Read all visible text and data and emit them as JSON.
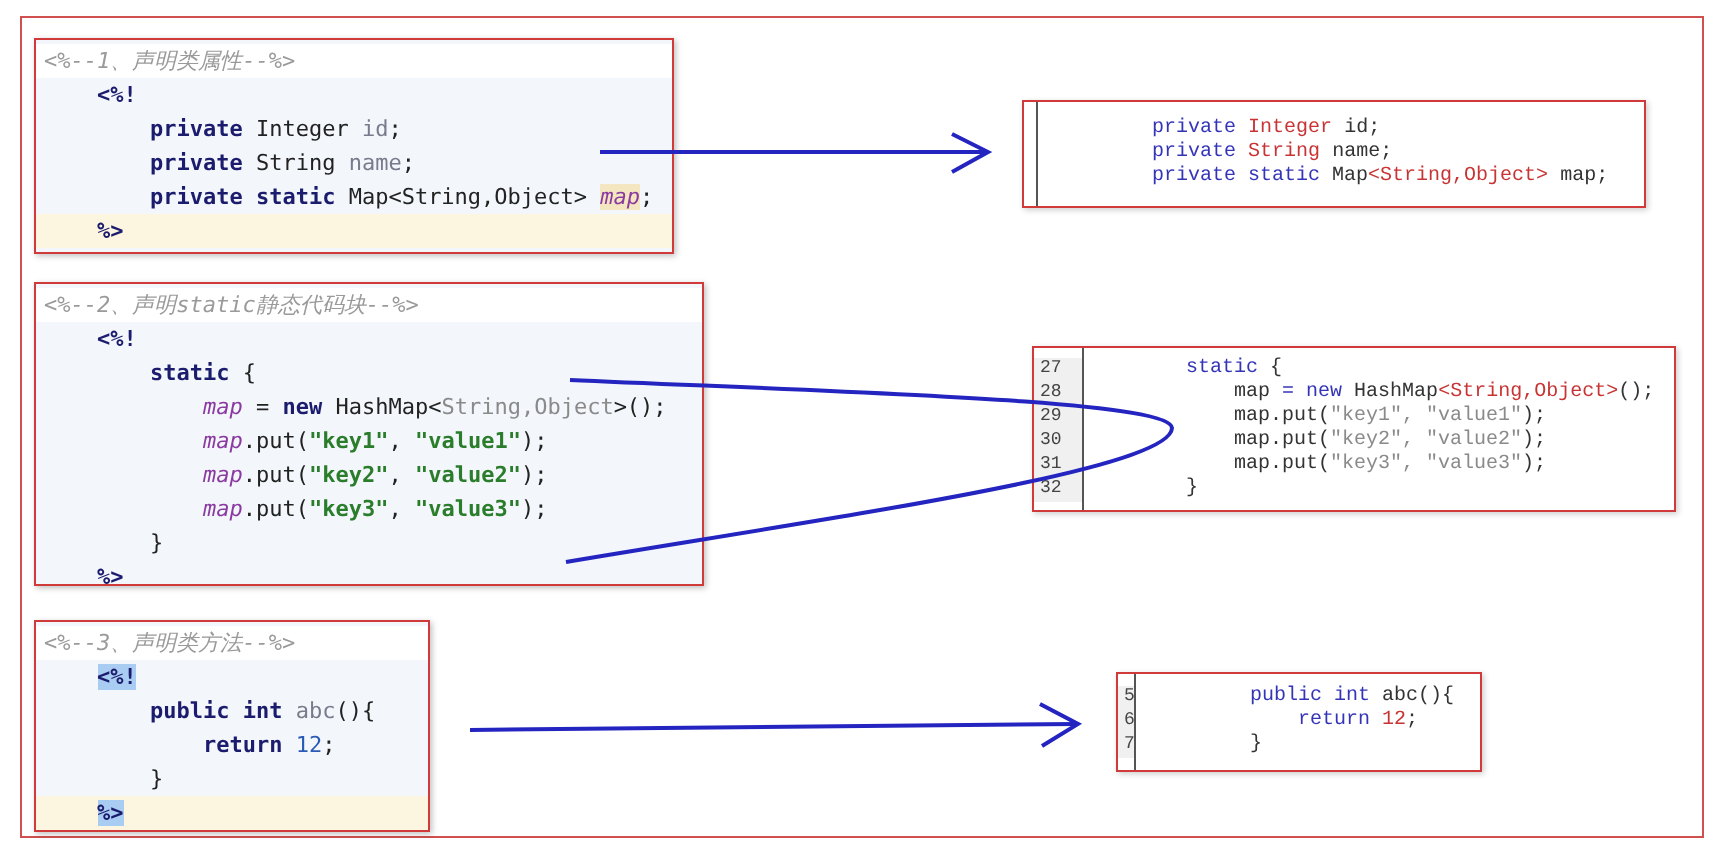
{
  "sections": [
    {
      "source": {
        "comment": "<%--1、声明类属性--%>",
        "lines": [
          {
            "kind": "code",
            "tokens": [
              {
                "text": "    <%!",
                "kind": "kw"
              }
            ]
          },
          {
            "kind": "code",
            "tokens": [
              {
                "text": "        private",
                "kind": "kw"
              },
              {
                "text": " Integer ",
                "kind": "plain"
              },
              {
                "text": "id",
                "kind": "field"
              },
              {
                "text": ";",
                "kind": "plain"
              }
            ]
          },
          {
            "kind": "code",
            "tokens": [
              {
                "text": "        private",
                "kind": "kw"
              },
              {
                "text": " String ",
                "kind": "plain"
              },
              {
                "text": "name",
                "kind": "field"
              },
              {
                "text": ";",
                "kind": "plain"
              }
            ]
          },
          {
            "kind": "code",
            "tokens": [
              {
                "text": "        private static",
                "kind": "kw"
              },
              {
                "text": " Map<String,Object> ",
                "kind": "plain"
              },
              {
                "text": "map",
                "kind": "mark"
              },
              {
                "text": ";",
                "kind": "plain"
              }
            ]
          },
          {
            "kind": "current",
            "tokens": [
              {
                "text": "    %>",
                "kind": "kw"
              }
            ]
          }
        ]
      },
      "result": {
        "lines": [
          {
            "tokens": [
              {
                "text": "         private ",
                "kind": "jkw"
              },
              {
                "text": "Integer",
                "kind": "jtype"
              },
              {
                "text": " id;",
                "kind": "jplain"
              }
            ]
          },
          {
            "tokens": [
              {
                "text": "         private ",
                "kind": "jkw"
              },
              {
                "text": "String",
                "kind": "jtype"
              },
              {
                "text": " name;",
                "kind": "jplain"
              }
            ]
          },
          {
            "tokens": [
              {
                "text": "         private static ",
                "kind": "jkw"
              },
              {
                "text": "Map",
                "kind": "jplain"
              },
              {
                "text": "<String,Object>",
                "kind": "jtype"
              },
              {
                "text": " map;",
                "kind": "jplain"
              }
            ]
          }
        ]
      }
    },
    {
      "source": {
        "comment": "<%--2、声明static静态代码块--%>",
        "lines": [
          {
            "kind": "code",
            "tokens": [
              {
                "text": "    <%!",
                "kind": "kw"
              }
            ]
          },
          {
            "kind": "code",
            "tokens": [
              {
                "text": "        static",
                "kind": "kw"
              },
              {
                "text": " {",
                "kind": "plain"
              }
            ]
          },
          {
            "kind": "code",
            "tokens": [
              {
                "text": "            map",
                "kind": "var"
              },
              {
                "text": " = ",
                "kind": "plain"
              },
              {
                "text": "new",
                "kind": "kw"
              },
              {
                "text": " HashMap<",
                "kind": "plain"
              },
              {
                "text": "String,Object",
                "kind": "gen"
              },
              {
                "text": ">();",
                "kind": "plain"
              }
            ]
          },
          {
            "kind": "code",
            "tokens": [
              {
                "text": "            map",
                "kind": "var"
              },
              {
                "text": ".put(",
                "kind": "plain"
              },
              {
                "text": "\"key1\"",
                "kind": "str"
              },
              {
                "text": ", ",
                "kind": "plain"
              },
              {
                "text": "\"value1\"",
                "kind": "str"
              },
              {
                "text": ");",
                "kind": "plain"
              }
            ]
          },
          {
            "kind": "code",
            "tokens": [
              {
                "text": "            map",
                "kind": "var"
              },
              {
                "text": ".put(",
                "kind": "plain"
              },
              {
                "text": "\"key2\"",
                "kind": "str"
              },
              {
                "text": ", ",
                "kind": "plain"
              },
              {
                "text": "\"value2\"",
                "kind": "str"
              },
              {
                "text": ");",
                "kind": "plain"
              }
            ]
          },
          {
            "kind": "code",
            "tokens": [
              {
                "text": "            map",
                "kind": "var"
              },
              {
                "text": ".put(",
                "kind": "plain"
              },
              {
                "text": "\"key3\"",
                "kind": "str"
              },
              {
                "text": ", ",
                "kind": "plain"
              },
              {
                "text": "\"value3\"",
                "kind": "str"
              },
              {
                "text": ");",
                "kind": "plain"
              }
            ]
          },
          {
            "kind": "code",
            "tokens": [
              {
                "text": "        }",
                "kind": "plain"
              }
            ]
          },
          {
            "kind": "code",
            "tokens": [
              {
                "text": "    %>",
                "kind": "kw"
              }
            ]
          }
        ]
      },
      "result": {
        "lines": [
          {
            "number": "27",
            "tokens": [
              {
                "text": "        static ",
                "kind": "jkw"
              },
              {
                "text": "{",
                "kind": "jplain"
              }
            ]
          },
          {
            "number": "28",
            "tokens": [
              {
                "text": "            map ",
                "kind": "jplain"
              },
              {
                "text": "= new ",
                "kind": "jkw"
              },
              {
                "text": "HashMap",
                "kind": "jplain"
              },
              {
                "text": "<String,Object>",
                "kind": "jtype"
              },
              {
                "text": "();",
                "kind": "jplain"
              }
            ]
          },
          {
            "number": "29",
            "tokens": [
              {
                "text": "            map.put(",
                "kind": "jplain"
              },
              {
                "text": "\"key1\", \"value1\"",
                "kind": "jstr"
              },
              {
                "text": ");",
                "kind": "jplain"
              }
            ]
          },
          {
            "number": "30",
            "tokens": [
              {
                "text": "            map.put(",
                "kind": "jplain"
              },
              {
                "text": "\"key2\", \"value2\"",
                "kind": "jstr"
              },
              {
                "text": ");",
                "kind": "jplain"
              }
            ]
          },
          {
            "number": "31",
            "tokens": [
              {
                "text": "            map.put(",
                "kind": "jplain"
              },
              {
                "text": "\"key3\", \"value3\"",
                "kind": "jstr"
              },
              {
                "text": ");",
                "kind": "jplain"
              }
            ]
          },
          {
            "number": "32",
            "tokens": [
              {
                "text": "        }",
                "kind": "jplain"
              }
            ]
          }
        ]
      }
    },
    {
      "source": {
        "comment": "<%--3、声明类方法--%>",
        "lines": [
          {
            "kind": "code",
            "tokens": [
              {
                "text": "    <%!",
                "kind": "sel"
              }
            ]
          },
          {
            "kind": "code",
            "tokens": [
              {
                "text": "        public int",
                "kind": "kw"
              },
              {
                "text": " abc",
                "kind": "field"
              },
              {
                "text": "(){",
                "kind": "plain"
              }
            ]
          },
          {
            "kind": "code",
            "tokens": [
              {
                "text": "            return",
                "kind": "kw"
              },
              {
                "text": " 12",
                "kind": "num"
              },
              {
                "text": ";",
                "kind": "plain"
              }
            ]
          },
          {
            "kind": "code",
            "tokens": [
              {
                "text": "        }",
                "kind": "plain"
              }
            ]
          },
          {
            "kind": "current",
            "tokens": [
              {
                "text": "    %>",
                "kind": "sel"
              }
            ]
          }
        ]
      },
      "result": {
        "lines": [
          {
            "number": "5",
            "tokens": [
              {
                "text": "         public int ",
                "kind": "jkw"
              },
              {
                "text": "abc(){",
                "kind": "jplain"
              }
            ]
          },
          {
            "number": "6",
            "tokens": [
              {
                "text": "             return ",
                "kind": "jkw"
              },
              {
                "text": "12",
                "kind": "jtype"
              },
              {
                "text": ";",
                "kind": "jplain"
              }
            ]
          },
          {
            "number": "7",
            "tokens": [
              {
                "text": "         }",
                "kind": "jplain"
              }
            ]
          }
        ]
      }
    }
  ]
}
